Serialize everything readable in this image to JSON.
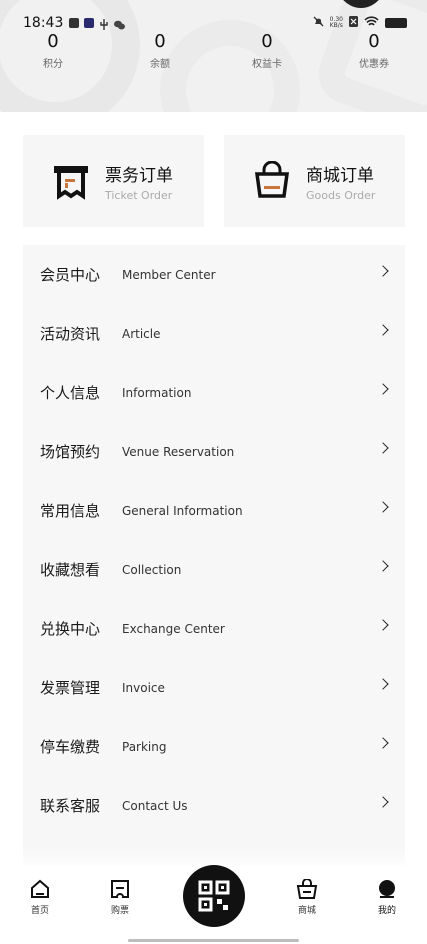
{
  "status": {
    "time": "18:43",
    "net_top": "0.30",
    "net_bottom": "KB/s"
  },
  "stats": [
    {
      "value": "0",
      "label": "积分"
    },
    {
      "value": "0",
      "label": "余额"
    },
    {
      "value": "0",
      "label": "权益卡"
    },
    {
      "value": "0",
      "label": "优惠券"
    }
  ],
  "orders": [
    {
      "zh": "票务订单",
      "en": "Ticket Order",
      "icon": "ticket-order-icon"
    },
    {
      "zh": "商城订单",
      "en": "Goods Order",
      "icon": "shopping-bag-icon"
    }
  ],
  "menu": [
    {
      "zh": "会员中心",
      "en": "Member Center"
    },
    {
      "zh": "活动资讯",
      "en": "Article"
    },
    {
      "zh": "个人信息",
      "en": "Information"
    },
    {
      "zh": "场馆预约",
      "en": "Venue Reservation"
    },
    {
      "zh": "常用信息",
      "en": "General Information"
    },
    {
      "zh": "收藏想看",
      "en": "Collection"
    },
    {
      "zh": "兑换中心",
      "en": "Exchange Center"
    },
    {
      "zh": "发票管理",
      "en": "Invoice"
    },
    {
      "zh": "停车缴费",
      "en": "Parking"
    },
    {
      "zh": "联系客服",
      "en": "Contact Us"
    }
  ],
  "tabs": [
    {
      "label": "首页",
      "icon": "home-icon"
    },
    {
      "label": "购票",
      "icon": "ticket-icon"
    },
    {
      "label": "商城",
      "icon": "cart-icon"
    },
    {
      "label": "我的",
      "icon": "profile-icon"
    }
  ],
  "colors": {
    "accent": "#c8763b",
    "dark": "#111111"
  }
}
